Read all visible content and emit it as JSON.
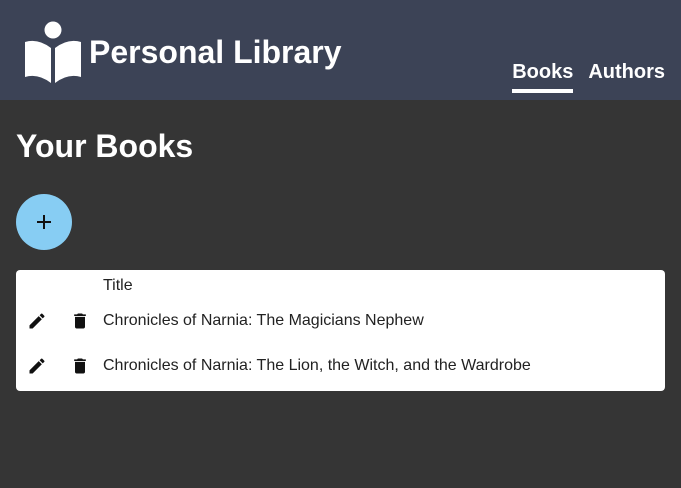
{
  "header": {
    "app_title": "Personal Library",
    "logo_icon": "reading-person-book-icon",
    "nav": [
      {
        "label": "Books",
        "active": true
      },
      {
        "label": "Authors",
        "active": false
      }
    ]
  },
  "main": {
    "page_title": "Your Books",
    "add_button": {
      "label": "+",
      "color": "#87cdf3"
    },
    "table": {
      "columns": [
        "Title"
      ],
      "rows": [
        {
          "title": "Chronicles of Narnia: The Magicians Nephew",
          "edit_icon": "pencil-icon",
          "delete_icon": "trash-icon"
        },
        {
          "title": "Chronicles of Narnia: The Lion, the Witch, and the Wardrobe",
          "edit_icon": "pencil-icon",
          "delete_icon": "trash-icon"
        }
      ]
    }
  },
  "colors": {
    "header_bg": "#3c4356",
    "page_bg": "#353535",
    "accent": "#87cdf3"
  }
}
